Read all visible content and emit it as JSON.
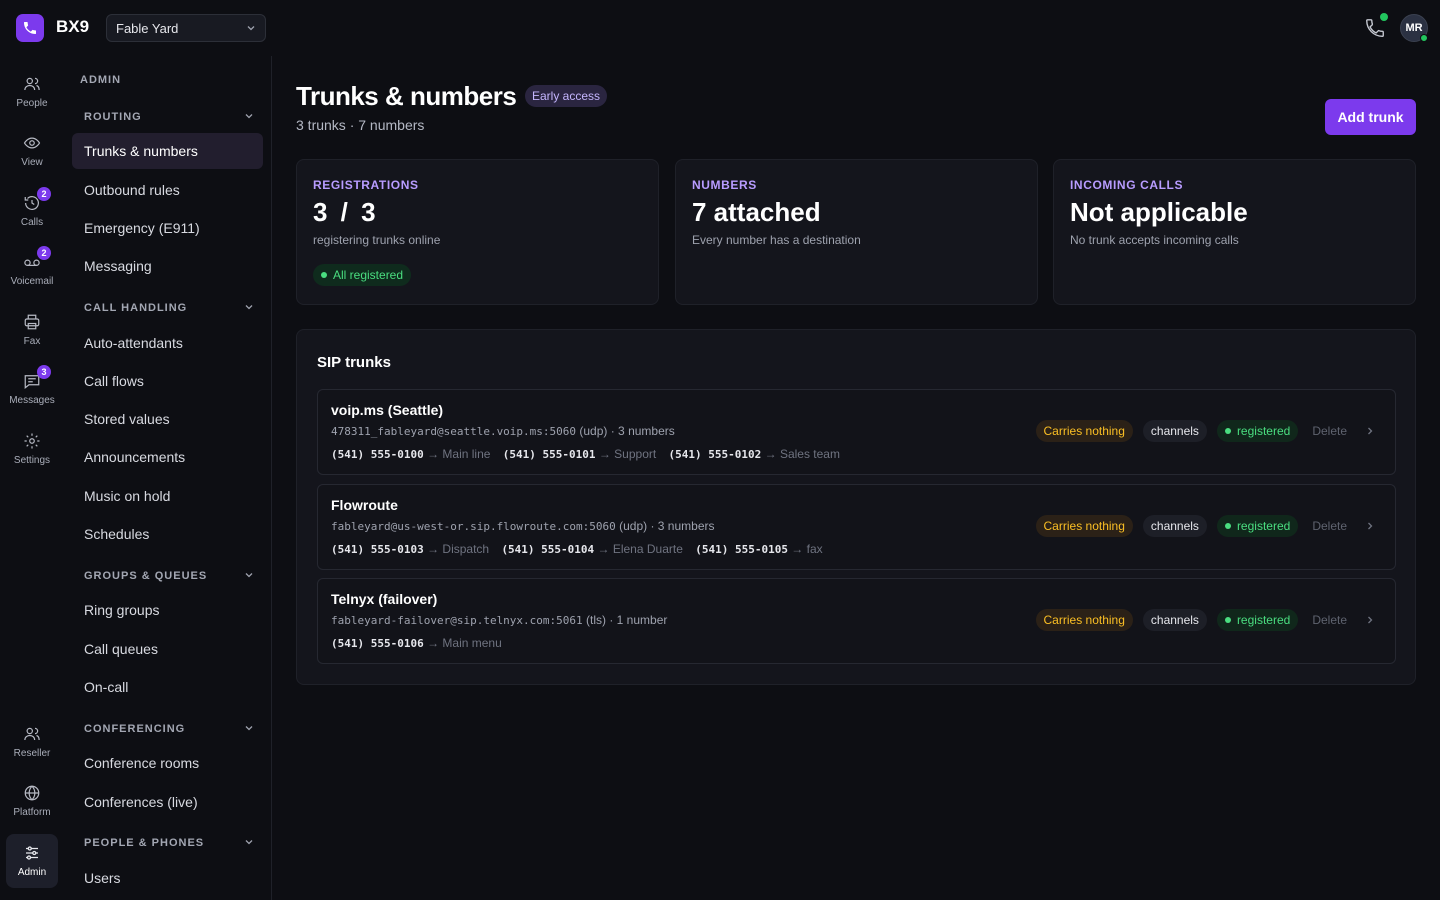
{
  "app": {
    "brand": "BX9",
    "org": "Fable Yard",
    "user_initials": "MR"
  },
  "rail": [
    {
      "label": "People",
      "icon": "people-icon",
      "badge": null
    },
    {
      "label": "View",
      "icon": "eye-icon",
      "badge": null
    },
    {
      "label": "Calls",
      "icon": "calls-history-icon",
      "badge": "2"
    },
    {
      "label": "Voicemail",
      "icon": "voicemail-icon",
      "badge": "2"
    },
    {
      "label": "Fax",
      "icon": "printer-icon",
      "badge": null
    },
    {
      "label": "Messages",
      "icon": "message-icon",
      "badge": "3"
    },
    {
      "label": "Settings",
      "icon": "gear-icon",
      "badge": null
    },
    {
      "label": "Reseller",
      "icon": "reseller-icon",
      "badge": null
    },
    {
      "label": "Platform",
      "icon": "globe-icon",
      "badge": null
    },
    {
      "label": "Admin",
      "icon": "sliders-icon",
      "badge": null
    }
  ],
  "subnav": {
    "heading": "ADMIN",
    "groups": [
      {
        "label": "ROUTING",
        "items": [
          "Trunks & numbers",
          "Outbound rules",
          "Emergency (E911)",
          "Messaging"
        ]
      },
      {
        "label": "CALL HANDLING",
        "items": [
          "Auto-attendants",
          "Call flows",
          "Stored values",
          "Announcements",
          "Music on hold",
          "Schedules"
        ]
      },
      {
        "label": "GROUPS & QUEUES",
        "items": [
          "Ring groups",
          "Call queues",
          "On-call"
        ]
      },
      {
        "label": "CONFERENCING",
        "items": [
          "Conference rooms",
          "Conferences (live)"
        ]
      },
      {
        "label": "PEOPLE & PHONES",
        "items": [
          "Users"
        ]
      }
    ]
  },
  "page": {
    "title": "Trunks & numbers",
    "badge": "Early access",
    "subtitle": "3 trunks · 7 numbers",
    "add_button": "Add trunk"
  },
  "cards": [
    {
      "key": "REGISTRATIONS",
      "value": "3 / 3",
      "sub": "registering trunks online",
      "pill": "All registered"
    },
    {
      "key": "NUMBERS",
      "value": "7 attached",
      "sub": "Every number has a destination"
    },
    {
      "key": "INCOMING CALLS",
      "value": "Not applicable",
      "sub": "No trunk accepts incoming calls"
    }
  ],
  "sip": {
    "title": "SIP trunks",
    "trunks": [
      {
        "name": "voip.ms (Seattle)",
        "host": "478311_fableyard@seattle.voip.ms:5060",
        "meta": " (udp) · 3 numbers",
        "numbers": [
          {
            "num": "(541) 555-0100",
            "dest": "→ Main line"
          },
          {
            "num": "(541) 555-0101",
            "dest": "→ Support"
          },
          {
            "num": "(541) 555-0102",
            "dest": "→ Sales team"
          }
        ],
        "tag_carry": "Carries nothing",
        "tag_chan": "channels",
        "tag_reg": "registered",
        "delete": "Delete"
      },
      {
        "name": "Flowroute",
        "host": "fableyard@us-west-or.sip.flowroute.com:5060",
        "meta": " (udp) · 3 numbers",
        "numbers": [
          {
            "num": "(541) 555-0103",
            "dest": "→ Dispatch"
          },
          {
            "num": "(541) 555-0104",
            "dest": "→ Elena Duarte"
          },
          {
            "num": "(541) 555-0105",
            "dest": "→ fax"
          }
        ],
        "tag_carry": "Carries nothing",
        "tag_chan": "channels",
        "tag_reg": "registered",
        "delete": "Delete"
      },
      {
        "name": "Telnyx (failover)",
        "host": "fableyard-failover@sip.telnyx.com:5061",
        "meta": " (tls) · 1 number",
        "numbers": [
          {
            "num": "(541) 555-0106",
            "dest": "→ Main menu"
          }
        ],
        "tag_carry": "Carries nothing",
        "tag_chan": "channels",
        "tag_reg": "registered",
        "delete": "Delete"
      }
    ]
  }
}
